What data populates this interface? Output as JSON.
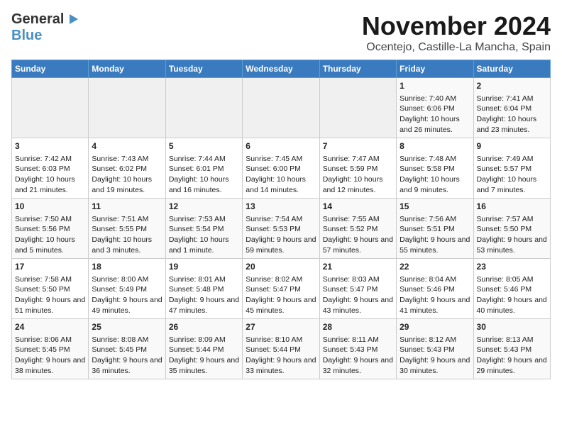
{
  "header": {
    "logo_line1": "General",
    "logo_line2": "Blue",
    "month": "November 2024",
    "location": "Ocentejo, Castille-La Mancha, Spain"
  },
  "days_of_week": [
    "Sunday",
    "Monday",
    "Tuesday",
    "Wednesday",
    "Thursday",
    "Friday",
    "Saturday"
  ],
  "weeks": [
    [
      {
        "day": "",
        "info": ""
      },
      {
        "day": "",
        "info": ""
      },
      {
        "day": "",
        "info": ""
      },
      {
        "day": "",
        "info": ""
      },
      {
        "day": "",
        "info": ""
      },
      {
        "day": "1",
        "info": "Sunrise: 7:40 AM\nSunset: 6:06 PM\nDaylight: 10 hours and 26 minutes."
      },
      {
        "day": "2",
        "info": "Sunrise: 7:41 AM\nSunset: 6:04 PM\nDaylight: 10 hours and 23 minutes."
      }
    ],
    [
      {
        "day": "3",
        "info": "Sunrise: 7:42 AM\nSunset: 6:03 PM\nDaylight: 10 hours and 21 minutes."
      },
      {
        "day": "4",
        "info": "Sunrise: 7:43 AM\nSunset: 6:02 PM\nDaylight: 10 hours and 19 minutes."
      },
      {
        "day": "5",
        "info": "Sunrise: 7:44 AM\nSunset: 6:01 PM\nDaylight: 10 hours and 16 minutes."
      },
      {
        "day": "6",
        "info": "Sunrise: 7:45 AM\nSunset: 6:00 PM\nDaylight: 10 hours and 14 minutes."
      },
      {
        "day": "7",
        "info": "Sunrise: 7:47 AM\nSunset: 5:59 PM\nDaylight: 10 hours and 12 minutes."
      },
      {
        "day": "8",
        "info": "Sunrise: 7:48 AM\nSunset: 5:58 PM\nDaylight: 10 hours and 9 minutes."
      },
      {
        "day": "9",
        "info": "Sunrise: 7:49 AM\nSunset: 5:57 PM\nDaylight: 10 hours and 7 minutes."
      }
    ],
    [
      {
        "day": "10",
        "info": "Sunrise: 7:50 AM\nSunset: 5:56 PM\nDaylight: 10 hours and 5 minutes."
      },
      {
        "day": "11",
        "info": "Sunrise: 7:51 AM\nSunset: 5:55 PM\nDaylight: 10 hours and 3 minutes."
      },
      {
        "day": "12",
        "info": "Sunrise: 7:53 AM\nSunset: 5:54 PM\nDaylight: 10 hours and 1 minute."
      },
      {
        "day": "13",
        "info": "Sunrise: 7:54 AM\nSunset: 5:53 PM\nDaylight: 9 hours and 59 minutes."
      },
      {
        "day": "14",
        "info": "Sunrise: 7:55 AM\nSunset: 5:52 PM\nDaylight: 9 hours and 57 minutes."
      },
      {
        "day": "15",
        "info": "Sunrise: 7:56 AM\nSunset: 5:51 PM\nDaylight: 9 hours and 55 minutes."
      },
      {
        "day": "16",
        "info": "Sunrise: 7:57 AM\nSunset: 5:50 PM\nDaylight: 9 hours and 53 minutes."
      }
    ],
    [
      {
        "day": "17",
        "info": "Sunrise: 7:58 AM\nSunset: 5:50 PM\nDaylight: 9 hours and 51 minutes."
      },
      {
        "day": "18",
        "info": "Sunrise: 8:00 AM\nSunset: 5:49 PM\nDaylight: 9 hours and 49 minutes."
      },
      {
        "day": "19",
        "info": "Sunrise: 8:01 AM\nSunset: 5:48 PM\nDaylight: 9 hours and 47 minutes."
      },
      {
        "day": "20",
        "info": "Sunrise: 8:02 AM\nSunset: 5:47 PM\nDaylight: 9 hours and 45 minutes."
      },
      {
        "day": "21",
        "info": "Sunrise: 8:03 AM\nSunset: 5:47 PM\nDaylight: 9 hours and 43 minutes."
      },
      {
        "day": "22",
        "info": "Sunrise: 8:04 AM\nSunset: 5:46 PM\nDaylight: 9 hours and 41 minutes."
      },
      {
        "day": "23",
        "info": "Sunrise: 8:05 AM\nSunset: 5:46 PM\nDaylight: 9 hours and 40 minutes."
      }
    ],
    [
      {
        "day": "24",
        "info": "Sunrise: 8:06 AM\nSunset: 5:45 PM\nDaylight: 9 hours and 38 minutes."
      },
      {
        "day": "25",
        "info": "Sunrise: 8:08 AM\nSunset: 5:45 PM\nDaylight: 9 hours and 36 minutes."
      },
      {
        "day": "26",
        "info": "Sunrise: 8:09 AM\nSunset: 5:44 PM\nDaylight: 9 hours and 35 minutes."
      },
      {
        "day": "27",
        "info": "Sunrise: 8:10 AM\nSunset: 5:44 PM\nDaylight: 9 hours and 33 minutes."
      },
      {
        "day": "28",
        "info": "Sunrise: 8:11 AM\nSunset: 5:43 PM\nDaylight: 9 hours and 32 minutes."
      },
      {
        "day": "29",
        "info": "Sunrise: 8:12 AM\nSunset: 5:43 PM\nDaylight: 9 hours and 30 minutes."
      },
      {
        "day": "30",
        "info": "Sunrise: 8:13 AM\nSunset: 5:43 PM\nDaylight: 9 hours and 29 minutes."
      }
    ]
  ]
}
